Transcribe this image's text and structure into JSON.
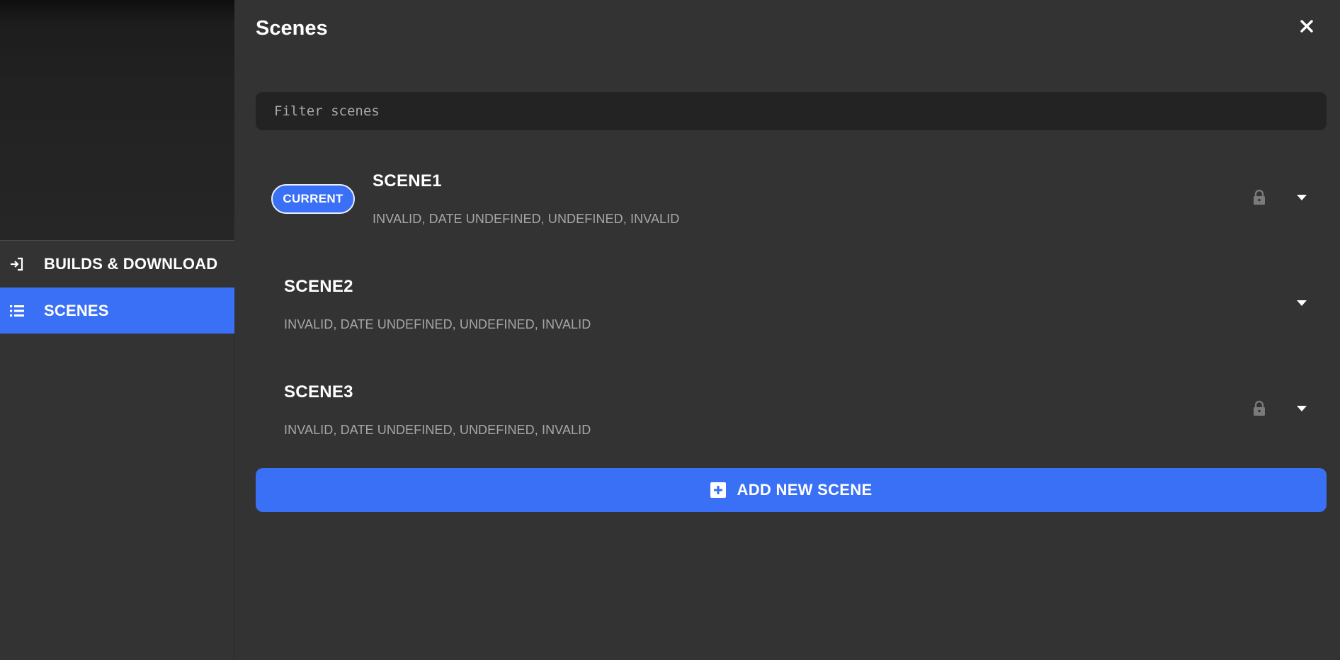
{
  "sidebar": {
    "items": [
      {
        "label": "BUILDS & DOWNLOAD",
        "icon": "sign-in-icon",
        "active": false
      },
      {
        "label": "SCENES",
        "icon": "list-icon",
        "active": true
      }
    ]
  },
  "header": {
    "title": "Scenes",
    "close_icon": "close-icon"
  },
  "filter": {
    "placeholder": "Filter scenes",
    "value": ""
  },
  "scenes": [
    {
      "name": "SCENE1",
      "meta": "INVALID, DATE UNDEFINED, UNDEFINED, INVALID",
      "badge": "CURRENT",
      "locked": true
    },
    {
      "name": "SCENE2",
      "meta": "INVALID, DATE UNDEFINED, UNDEFINED, INVALID",
      "badge": "",
      "locked": false
    },
    {
      "name": "SCENE3",
      "meta": "INVALID, DATE UNDEFINED, UNDEFINED, INVALID",
      "badge": "",
      "locked": true
    }
  ],
  "add_button": {
    "label": "ADD NEW SCENE",
    "icon": "plus-square-icon"
  },
  "colors": {
    "accent": "#3a70f5",
    "background": "#333333",
    "input_background": "#232323",
    "muted_text": "#a7a7a7"
  }
}
